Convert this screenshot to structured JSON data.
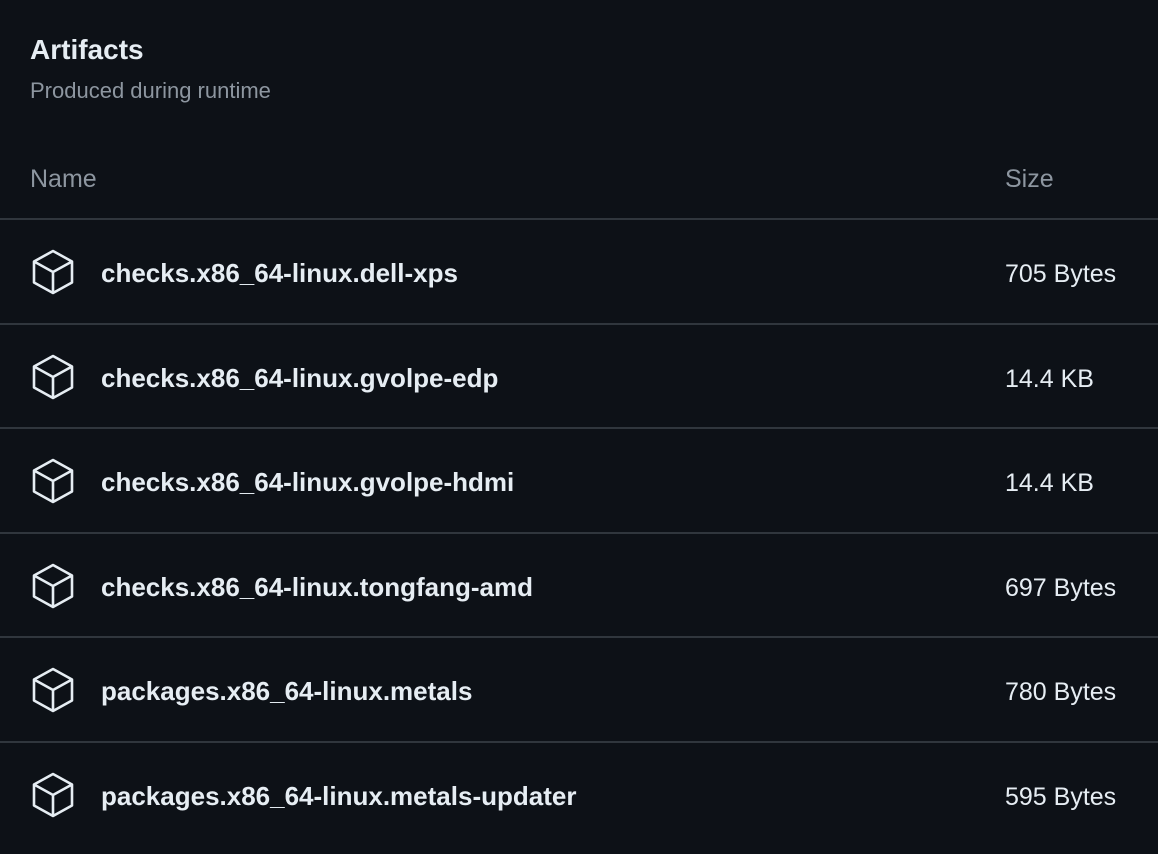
{
  "artifacts": {
    "title": "Artifacts",
    "subtitle": "Produced during runtime",
    "columns": {
      "name": "Name",
      "size": "Size"
    },
    "icon": "package-icon",
    "items": [
      {
        "name": "checks.x86_64-linux.dell-xps",
        "size": "705 Bytes"
      },
      {
        "name": "checks.x86_64-linux.gvolpe-edp",
        "size": "14.4 KB"
      },
      {
        "name": "checks.x86_64-linux.gvolpe-hdmi",
        "size": "14.4 KB"
      },
      {
        "name": "checks.x86_64-linux.tongfang-amd",
        "size": "697 Bytes"
      },
      {
        "name": "packages.x86_64-linux.metals",
        "size": "780 Bytes"
      },
      {
        "name": "packages.x86_64-linux.metals-updater",
        "size": "595 Bytes"
      }
    ]
  },
  "colors": {
    "background": "#0d1117",
    "text": "#e6edf3",
    "muted": "#8d96a0",
    "border": "#30363d"
  }
}
